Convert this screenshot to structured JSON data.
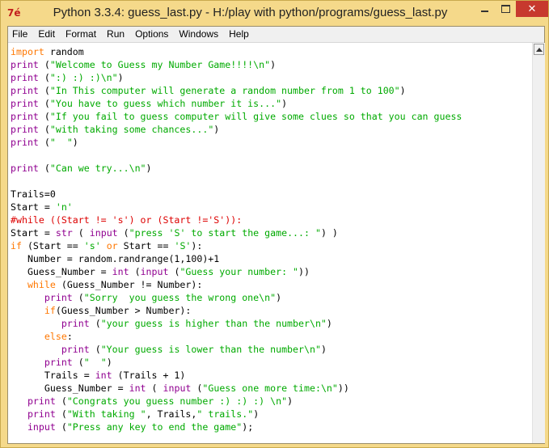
{
  "window": {
    "title": "Python 3.3.4: guess_last.py - H:/play with python/programs/guess_last.py",
    "icon_glyph": "7é"
  },
  "menu": [
    "File",
    "Edit",
    "Format",
    "Run",
    "Options",
    "Windows",
    "Help"
  ],
  "colors": {
    "keyword": "#ff7700",
    "string": "#00aa00",
    "comment": "#dd0000",
    "builtin": "#900090",
    "titlebar": "#f5d98a",
    "close_button": "#c7392e"
  },
  "code_lines": [
    [
      [
        "kw",
        "import"
      ],
      [
        "id",
        " random"
      ]
    ],
    [
      [
        "bi",
        "print"
      ],
      [
        "id",
        " ("
      ],
      [
        "str",
        "\"Welcome to Guess my Number Game!!!!\\n\""
      ],
      [
        "id",
        ")"
      ]
    ],
    [
      [
        "bi",
        "print"
      ],
      [
        "id",
        " ("
      ],
      [
        "str",
        "\":) :) :)\\n\""
      ],
      [
        "id",
        ")"
      ]
    ],
    [
      [
        "bi",
        "print"
      ],
      [
        "id",
        " ("
      ],
      [
        "str",
        "\"In This computer will generate a random number from 1 to 100\""
      ],
      [
        "id",
        ")"
      ]
    ],
    [
      [
        "bi",
        "print"
      ],
      [
        "id",
        " ("
      ],
      [
        "str",
        "\"You have to guess which number it is...\""
      ],
      [
        "id",
        ")"
      ]
    ],
    [
      [
        "bi",
        "print"
      ],
      [
        "id",
        " ("
      ],
      [
        "str",
        "\"If you fail to guess computer will give some clues so that you can guess"
      ]
    ],
    [
      [
        "bi",
        "print"
      ],
      [
        "id",
        " ("
      ],
      [
        "str",
        "\"with taking some chances...\""
      ],
      [
        "id",
        ")"
      ]
    ],
    [
      [
        "bi",
        "print"
      ],
      [
        "id",
        " ("
      ],
      [
        "str",
        "\"  \""
      ],
      [
        "id",
        ")"
      ]
    ],
    [],
    [
      [
        "bi",
        "print"
      ],
      [
        "id",
        " ("
      ],
      [
        "str",
        "\"Can we try...\\n\""
      ],
      [
        "id",
        ")"
      ]
    ],
    [],
    [
      [
        "id",
        "Trails=0"
      ]
    ],
    [
      [
        "id",
        "Start = "
      ],
      [
        "str",
        "'n'"
      ]
    ],
    [
      [
        "cmt",
        "#while ((Start != 's') or (Start !='S')):"
      ]
    ],
    [
      [
        "id",
        "Start = "
      ],
      [
        "bi",
        "str"
      ],
      [
        "id",
        " ( "
      ],
      [
        "bi",
        "input"
      ],
      [
        "id",
        " ("
      ],
      [
        "str",
        "\"press 'S' to start the game...: \""
      ],
      [
        "id",
        ") )"
      ]
    ],
    [
      [
        "kw",
        "if"
      ],
      [
        "id",
        " (Start == "
      ],
      [
        "str",
        "'s'"
      ],
      [
        "id",
        " "
      ],
      [
        "kw",
        "or"
      ],
      [
        "id",
        " Start == "
      ],
      [
        "str",
        "'S'"
      ],
      [
        "id",
        "):"
      ]
    ],
    [
      [
        "id",
        "   Number = random.randrange(1,100)+1"
      ]
    ],
    [
      [
        "id",
        "   Guess_Number = "
      ],
      [
        "bi",
        "int"
      ],
      [
        "id",
        " ("
      ],
      [
        "bi",
        "input"
      ],
      [
        "id",
        " ("
      ],
      [
        "str",
        "\"Guess your number: \""
      ],
      [
        "id",
        "))"
      ]
    ],
    [
      [
        "id",
        "   "
      ],
      [
        "kw",
        "while"
      ],
      [
        "id",
        " (Guess_Number != Number):"
      ]
    ],
    [
      [
        "id",
        "      "
      ],
      [
        "bi",
        "print"
      ],
      [
        "id",
        " ("
      ],
      [
        "str",
        "\"Sorry  you guess the wrong one\\n\""
      ],
      [
        "id",
        ")"
      ]
    ],
    [
      [
        "id",
        "      "
      ],
      [
        "kw",
        "if"
      ],
      [
        "id",
        "(Guess_Number > Number):"
      ]
    ],
    [
      [
        "id",
        "         "
      ],
      [
        "bi",
        "print"
      ],
      [
        "id",
        " ("
      ],
      [
        "str",
        "\"your guess is higher than the number\\n\""
      ],
      [
        "id",
        ")"
      ]
    ],
    [
      [
        "id",
        "      "
      ],
      [
        "kw",
        "else"
      ],
      [
        "id",
        ":"
      ]
    ],
    [
      [
        "id",
        "         "
      ],
      [
        "bi",
        "print"
      ],
      [
        "id",
        " ("
      ],
      [
        "str",
        "\"Your guess is lower than the number\\n\""
      ],
      [
        "id",
        ")"
      ]
    ],
    [
      [
        "id",
        "      "
      ],
      [
        "bi",
        "print"
      ],
      [
        "id",
        " ("
      ],
      [
        "str",
        "\"  \""
      ],
      [
        "id",
        ")"
      ]
    ],
    [
      [
        "id",
        "      Trails = "
      ],
      [
        "bi",
        "int"
      ],
      [
        "id",
        " (Trails + 1)"
      ]
    ],
    [
      [
        "id",
        "      Guess_Number = "
      ],
      [
        "bi",
        "int"
      ],
      [
        "id",
        " ( "
      ],
      [
        "bi",
        "input"
      ],
      [
        "id",
        " ("
      ],
      [
        "str",
        "\"Guess one more time:\\n\""
      ],
      [
        "id",
        "))"
      ]
    ],
    [
      [
        "id",
        "   "
      ],
      [
        "bi",
        "print"
      ],
      [
        "id",
        " ("
      ],
      [
        "str",
        "\"Congrats you guess number :) :) :) \\n\""
      ],
      [
        "id",
        ")"
      ]
    ],
    [
      [
        "id",
        "   "
      ],
      [
        "bi",
        "print"
      ],
      [
        "id",
        " ("
      ],
      [
        "str",
        "\"With taking \""
      ],
      [
        "id",
        ", Trails,"
      ],
      [
        "str",
        "\" trails.\""
      ],
      [
        "id",
        ")"
      ]
    ],
    [
      [
        "id",
        "   "
      ],
      [
        "bi",
        "input"
      ],
      [
        "id",
        " ("
      ],
      [
        "str",
        "\"Press any key to end the game\""
      ],
      [
        "id",
        ");"
      ]
    ]
  ]
}
